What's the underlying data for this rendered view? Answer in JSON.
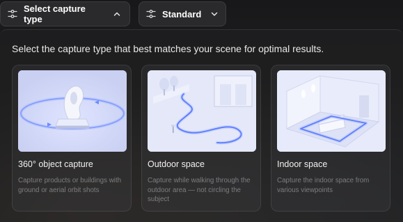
{
  "toolbar": {
    "capture_type_label": "Select capture type",
    "quality_label": "Standard",
    "capture_icon": "sliders-icon",
    "capture_chevron": "chevron-up-icon",
    "quality_icon": "sliders-icon",
    "quality_chevron": "chevron-down-icon"
  },
  "panel": {
    "title": "Select the capture type that best matches your scene for optimal results.",
    "cards": [
      {
        "title": "360° object capture",
        "description": "Capture products or buildings with ground or aerial orbit shots",
        "illustration": "object-orbit-illustration"
      },
      {
        "title": "Outdoor space",
        "description": "Capture while walking through the outdoor area — not circling the subject",
        "illustration": "outdoor-path-illustration"
      },
      {
        "title": "Indoor space",
        "description": "Capture the indoor space from various viewpoints",
        "illustration": "indoor-room-illustration"
      }
    ]
  },
  "colors": {
    "accent_glow": "#5b7cff",
    "panel_bg": "#1e1e20",
    "desc_text": "#7d7d80"
  }
}
